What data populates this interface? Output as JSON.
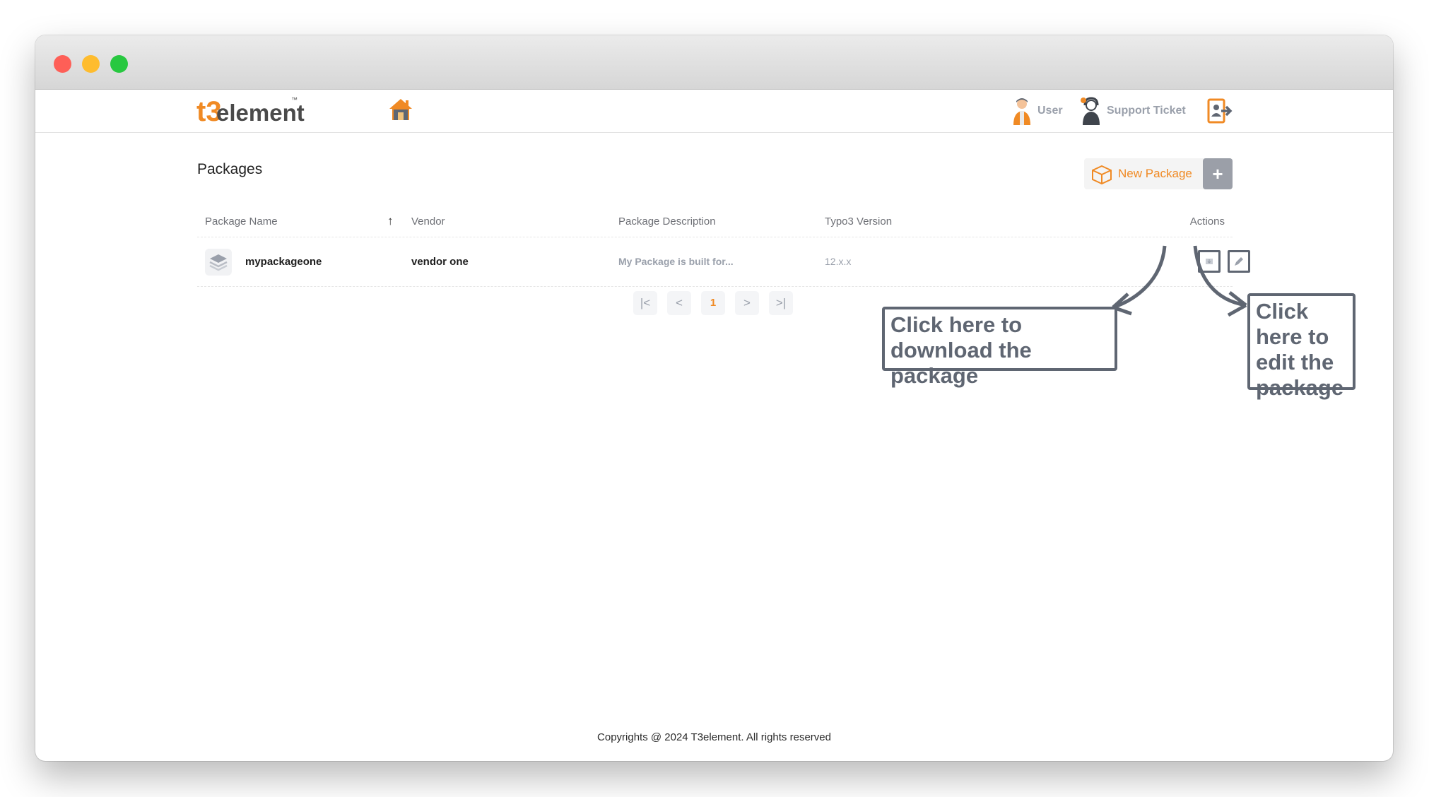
{
  "brand": {
    "logo_mark": "t3",
    "logo_text": "element",
    "logo_tm": "™"
  },
  "nav": {
    "user_label": "User",
    "support_label": "Support Ticket",
    "icons": {
      "home": "home-icon",
      "user": "user-avatar-icon",
      "support": "support-agent-icon",
      "logout": "logout-icon"
    }
  },
  "page": {
    "title": "Packages",
    "new_button_label": "New Package",
    "new_button_plus": "+"
  },
  "table": {
    "headers": {
      "name": "Package Name",
      "sort_indicator": "↑",
      "vendor": "Vendor",
      "description": "Package Description",
      "typo3": "Typo3 Version",
      "actions": "Actions"
    },
    "rows": [
      {
        "name": "mypackageone",
        "vendor": "vendor one",
        "description": "My Package is built for...",
        "typo3": "12.x.x"
      }
    ]
  },
  "pagination": {
    "first": "|<",
    "prev": "<",
    "current": "1",
    "next": ">",
    "last": ">|"
  },
  "annotations": {
    "download": "Click here to download the package",
    "edit": "Click here to edit the package"
  },
  "footer": {
    "text": "Copyrights @ 2024 T3element. All rights reserved"
  },
  "colors": {
    "accent": "#f08a24",
    "annotation": "#5f6672",
    "muted": "#9aa0ab"
  }
}
